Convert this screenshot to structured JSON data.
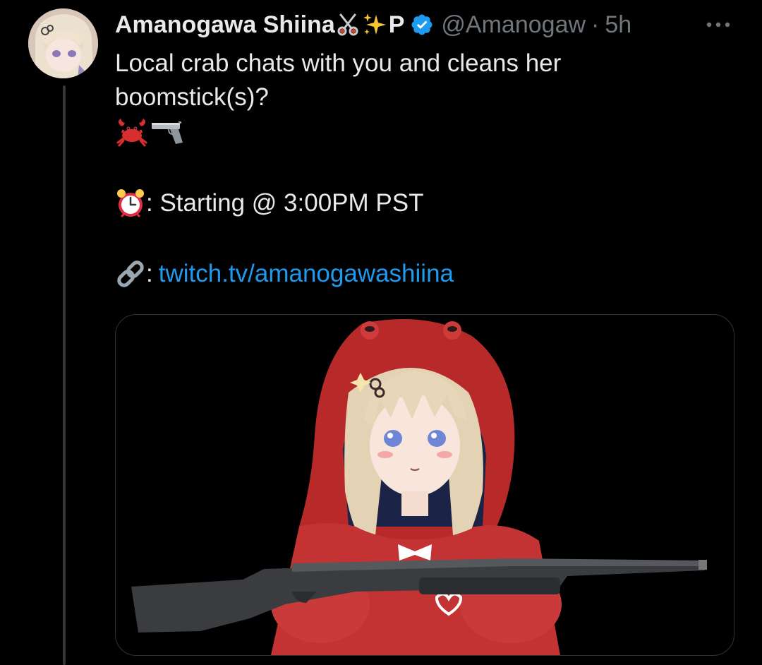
{
  "tweet": {
    "display_name": "Amanogawa Shiina",
    "name_suffix": "P",
    "handle": "@Amanogaw",
    "separator": "·",
    "time": "5h",
    "text_line_1": "Local crab chats with you and cleans her",
    "text_line_2": "boomstick(s)?",
    "start_text": ": Starting @ 3:00PM PST",
    "link_prefix": ":",
    "link_text": "twitch.tv/amanogawashiina"
  },
  "icons": {
    "name_decorations": [
      "scissors-icon",
      "sparkles-icon"
    ],
    "verified": "verified-badge-icon",
    "more": "more-options-icon",
    "emoji_line": [
      "crab-emoji",
      "pistol-emoji"
    ],
    "start_emoji": "alarm-clock-emoji",
    "link_emoji": "link-emoji"
  },
  "colors": {
    "background": "#000000",
    "text": "#e7e9ea",
    "muted": "#71767b",
    "link": "#1d9bf0",
    "verified": "#1d9bf0",
    "thread_line": "#333639"
  }
}
